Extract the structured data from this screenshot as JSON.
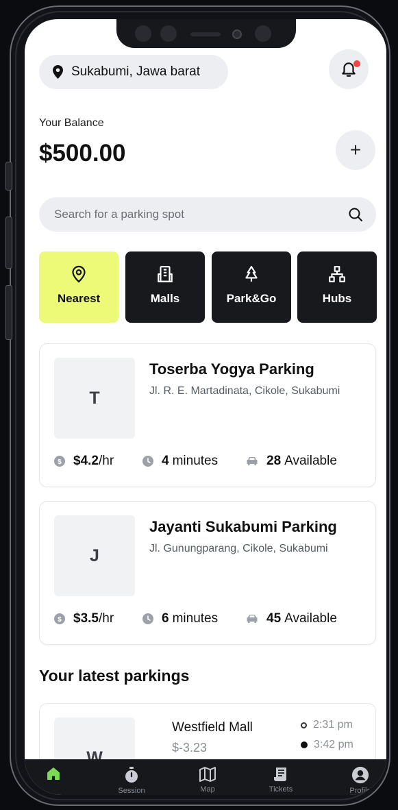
{
  "header": {
    "location": "Sukabumi, Jawa barat"
  },
  "balance": {
    "label": "Your Balance",
    "value": "$500.00"
  },
  "search": {
    "placeholder": "Search for a parking spot"
  },
  "categories": [
    {
      "label": "Nearest",
      "icon": "location-pin-icon",
      "active": true
    },
    {
      "label": "Malls",
      "icon": "building-icon",
      "active": false
    },
    {
      "label": "Park&Go",
      "icon": "tree-icon",
      "active": false
    },
    {
      "label": "Hubs",
      "icon": "network-icon",
      "active": false
    }
  ],
  "spots": [
    {
      "initial": "T",
      "name": "Toserba Yogya Parking",
      "address": "Jl. R. E. Martadinata, Cikole, Sukabumi",
      "price": "$4.2",
      "price_unit": "/hr",
      "time": "4",
      "time_unit": "minutes",
      "available": "28",
      "available_unit": "Available"
    },
    {
      "initial": "J",
      "name": "Jayanti Sukabumi Parking",
      "address": "Jl. Gunungparang, Cikole, Sukabumi",
      "price": "$3.5",
      "price_unit": "/hr",
      "time": "6",
      "time_unit": "minutes",
      "available": "45",
      "available_unit": "Available"
    }
  ],
  "latest": {
    "title": "Your latest parkings",
    "items": [
      {
        "initial": "W",
        "name": "Westfield Mall",
        "amount": "$-3.23",
        "start": "2:31 pm",
        "end": "3:42 pm"
      }
    ]
  },
  "nav": [
    {
      "label": "",
      "icon": "home-icon",
      "active": true
    },
    {
      "label": "Session",
      "icon": "stopwatch-icon",
      "active": false
    },
    {
      "label": "Map",
      "icon": "map-icon",
      "active": false
    },
    {
      "label": "Tickets",
      "icon": "receipt-icon",
      "active": false
    },
    {
      "label": "Profile",
      "icon": "user-icon",
      "active": false
    }
  ],
  "colors": {
    "accent": "#ecfa78",
    "dark": "#18191d",
    "surface": "#eceef1",
    "notification": "#ef4444",
    "nav_active": "#7ed957"
  }
}
